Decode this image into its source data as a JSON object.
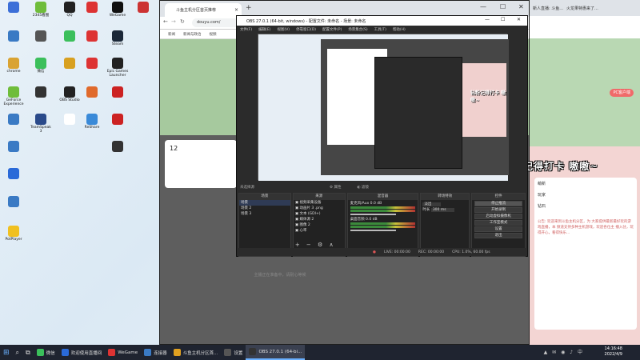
{
  "desktop_icons": [
    {
      "label": "",
      "color": "#3c6fd8"
    },
    {
      "label": "2345看图",
      "color": "#6fbd3b"
    },
    {
      "label": "QQ",
      "color": "#222"
    },
    {
      "label": "",
      "color": "#d33"
    },
    {
      "label": "WeGame",
      "color": "#111"
    },
    {
      "label": "",
      "color": "#c33"
    },
    {
      "label": "",
      "color": "#3a7ac4"
    },
    {
      "label": "",
      "color": "#555"
    },
    {
      "label": "",
      "color": "#3bbf5b"
    },
    {
      "label": "",
      "color": "#d33"
    },
    {
      "label": "Steam",
      "color": "#1b2838"
    },
    {
      "label": "chrome",
      "color": "#d9a332"
    },
    {
      "label": "微信",
      "color": "#3bbf5b"
    },
    {
      "label": "",
      "color": "#d8a020"
    },
    {
      "label": "",
      "color": "#d33"
    },
    {
      "label": "Epic Games Launcher",
      "color": "#222"
    },
    {
      "label": "GeForce Experience",
      "color": "#6fbd3b"
    },
    {
      "label": "",
      "color": "#333"
    },
    {
      "label": "OBS Studio",
      "color": "#222"
    },
    {
      "label": "",
      "color": "#e06a2b"
    },
    {
      "label": "",
      "color": "#c22"
    },
    {
      "label": "",
      "color": "#3a7ac4"
    },
    {
      "label": "TeamSpeak 3",
      "color": "#2a4a8a"
    },
    {
      "label": "",
      "color": "#fff"
    },
    {
      "label": "ReShare",
      "color": "#3a8ad8"
    },
    {
      "label": "",
      "color": "#c22"
    },
    {
      "label": "",
      "color": "#3a7ac4"
    },
    {
      "label": "",
      "color": "#333"
    },
    {
      "label": "",
      "color": "#2a6ad8"
    },
    {
      "label": "",
      "color": "#3a7ac4"
    },
    {
      "label": "PotPlayer",
      "color": "#f0c020"
    }
  ],
  "browser": {
    "tab_title": "斗鱼主机分区首页推荐",
    "address": "douyu.com/",
    "bookmarks": [
      "新闻",
      "新闻与政治",
      "视频"
    ]
  },
  "obs": {
    "title": "OBS 27.0.1 (64-bit, windows) - 配置文件: 未命名 - 场景: 未命名",
    "menu": [
      "文件(F)",
      "编辑(E)",
      "视图(V)",
      "停靠窗口(D)",
      "配置文件(P)",
      "场景集合(S)",
      "工具(T)",
      "帮助(H)"
    ],
    "no_source_selected": "未选择源",
    "props_label": "属性",
    "filters_label": "滤镜",
    "docks": {
      "scenes": {
        "title": "场景",
        "items": [
          "场景",
          "场景 2",
          "场景 3"
        ]
      },
      "sources": {
        "title": "来源",
        "items": [
          "视频采集设备",
          "动画片 3 .png",
          "文本 (GDI+)",
          "媒体源 2",
          "图像 2",
          "心率"
        ]
      },
      "mixer": {
        "title": "混音器",
        "channels": [
          {
            "name": "麦克风/Aux",
            "level": "0.0 dB"
          },
          {
            "name": "桌面音频",
            "level": "0.0 dB"
          }
        ]
      },
      "transitions": {
        "title": "转场特效",
        "type": "淡出",
        "duration_label": "时长",
        "duration": "300 ms"
      },
      "controls": {
        "title": "控件",
        "buttons": [
          "停止推流",
          "开始录制",
          "启动虚拟摄像机",
          "工作室模式",
          "设置",
          "退出"
        ]
      }
    },
    "status": {
      "live": "LIVE: 00:00:00",
      "rec": "REC: 00:00:00",
      "cpu": "CPU: 1.0%, 60.00 fps"
    }
  },
  "site": {
    "tab": "新人直播: 斗鱼...",
    "tab2": "火龙果特惠来了...",
    "banner_label": "PC客户端",
    "card_items": [
      "萌新",
      "玩家",
      "钻石"
    ],
    "viewer_count": "12",
    "notice": "公告: 欢迎来到斗鱼主机分区，为 大家提供最新最好玩的游戏直播，本 频道支持多种主机游戏，欢迎各位主 播入驻，玩得开心，看得快乐..."
  },
  "overlay_text": "钻粉记得打卡 嗷嗷~",
  "preview_overlay_text": "钻粉记得打卡 嗷嗷~",
  "placeholder": "主播正在准备中，请耐心等候",
  "taskbar": {
    "items": [
      {
        "label": "微信",
        "color": "#3bbf5b"
      },
      {
        "label": "欢迎使用直播间",
        "color": "#2a6ad8"
      },
      {
        "label": "WeGame",
        "color": "#d33"
      },
      {
        "label": "连接器",
        "color": "#3a7ac4"
      },
      {
        "label": "斗鱼主机分区首...",
        "color": "#e0a020"
      },
      {
        "label": "设置",
        "color": "#555"
      },
      {
        "label": "OBS 27.0.1 (64-bi...",
        "color": "#333",
        "active": true
      }
    ],
    "time": "14:16:48",
    "date": "2022/4/9"
  }
}
